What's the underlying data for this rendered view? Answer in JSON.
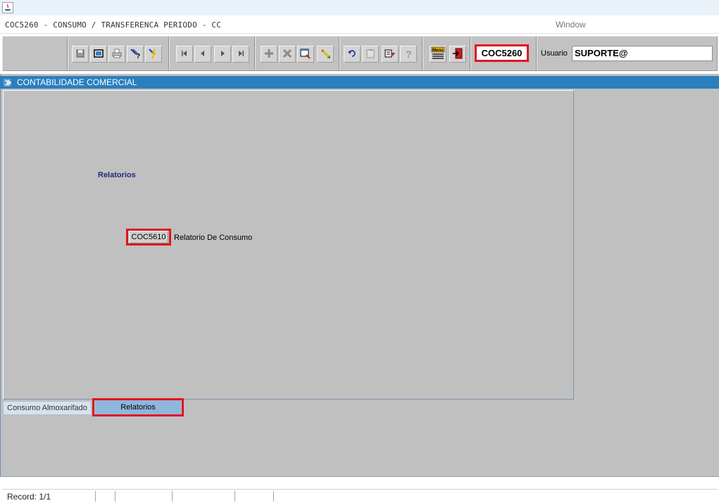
{
  "window": {
    "title": "COC5260 - CONSUMO / TRANSFERENCA PERIODO - CC",
    "menu_window": "Window"
  },
  "toolbar": {
    "buttons": [
      {
        "icon": "save-icon"
      },
      {
        "icon": "window-icon"
      },
      {
        "icon": "print-icon"
      },
      {
        "icon": "query-help-icon"
      },
      {
        "icon": "execute-query-icon"
      },
      {
        "icon": "first-record-icon"
      },
      {
        "icon": "previous-record-icon"
      },
      {
        "icon": "next-record-icon"
      },
      {
        "icon": "last-record-icon"
      },
      {
        "icon": "insert-record-icon"
      },
      {
        "icon": "delete-record-icon"
      },
      {
        "icon": "duplicate-record-icon"
      },
      {
        "icon": "edit-record-icon"
      },
      {
        "icon": "undo-icon"
      },
      {
        "icon": "clipboard-icon"
      },
      {
        "icon": "lov-icon"
      },
      {
        "icon": "help-icon"
      },
      {
        "icon": "menu-icon",
        "label": "Menu"
      },
      {
        "icon": "exit-icon"
      }
    ],
    "form_code": "COC5260",
    "usuario_label": "Usuario",
    "usuario_value": "SUPORTE@"
  },
  "section": {
    "title": "CONTABILIDADE COMERCIAL"
  },
  "relatorios": {
    "frame_title": "Relatorios",
    "report_button": "COC5610",
    "report_label": "Relatorio De Consumo"
  },
  "tabs": [
    {
      "label": "Consumo Almoxarifado",
      "active": false
    },
    {
      "label": "Relatorios",
      "active": true
    }
  ],
  "status": {
    "record": "Record: 1/1"
  },
  "colors": {
    "header_blue": "#2b7fbd",
    "highlight_red": "#e0141e",
    "active_tab": "#8fb6dc",
    "form_background": "#c0c0c0"
  }
}
